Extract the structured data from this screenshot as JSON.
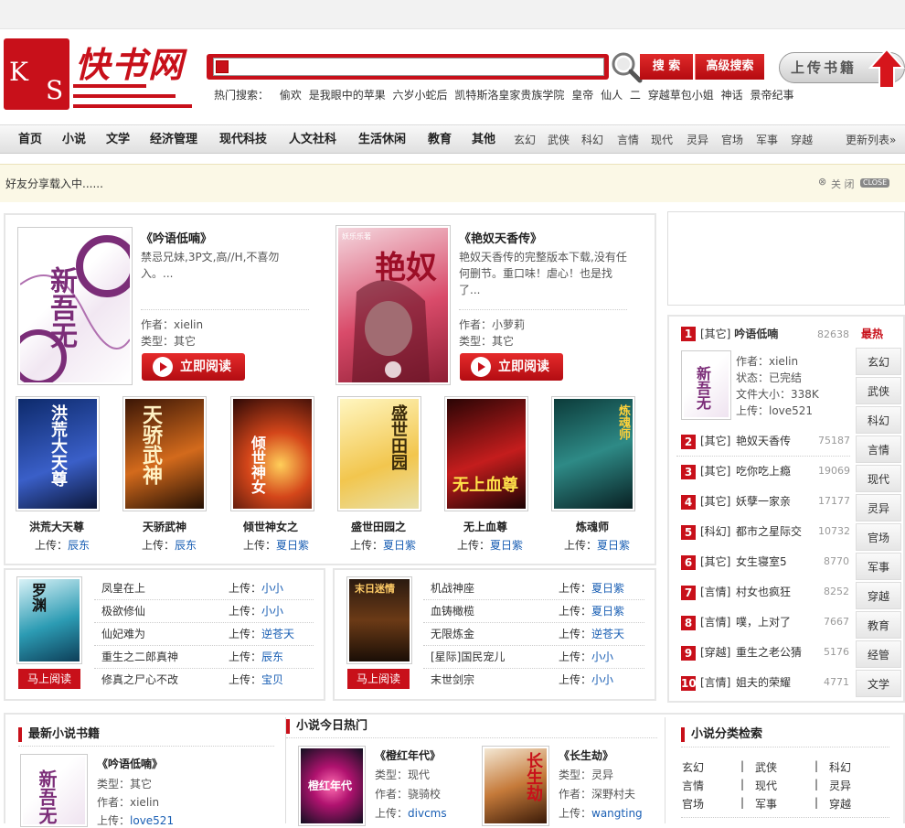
{
  "logo": {
    "ks_k": "K",
    "ks_s": "S",
    "name": "快书网"
  },
  "search": {
    "placeholder": "",
    "button": "搜 索",
    "advanced": "高级搜索",
    "upload": "上传书籍"
  },
  "hot": {
    "label": "热门搜索：",
    "items": [
      "偷欢",
      "是我眼中的苹果",
      "六岁小蛇后",
      "凯特斯洛皇家贵族学院",
      "皇帝",
      "仙人",
      "二",
      "穿越草包小姐",
      "神话",
      "景帝纪事"
    ]
  },
  "nav": {
    "main": [
      "首页",
      "小说",
      "文学",
      "经济管理",
      "现代科技",
      "人文社科",
      "生活休闲",
      "教育",
      "其他"
    ],
    "sub": [
      "玄幻",
      "武侠",
      "科幻",
      "言情",
      "现代",
      "灵异",
      "官场",
      "军事",
      "穿越"
    ],
    "more": "更新列表»"
  },
  "share": {
    "text": "好友分享载入中......",
    "close": "关 闭",
    "close_en": "CLOSE"
  },
  "featured": [
    {
      "title": "《吟语低喃》",
      "desc": "禁忌兄妹,3P文,高//H,不喜勿入。...",
      "author_label": "作者：",
      "author": "xielin",
      "type_label": "类型：",
      "type": "其它",
      "read": "立即阅读"
    },
    {
      "title": "《艳奴天香传》",
      "desc": "艳奴天香传的完整版本下载,没有任何删节。重口味！虐心！也是找了...",
      "author_label": "作者：",
      "author": "小萝莉",
      "type_label": "类型：",
      "type": "其它",
      "read": "立即阅读"
    }
  ],
  "cover_texts": {
    "c1": "新吾无",
    "c2": "艳奴",
    "c2_top": "妖乐乐著"
  },
  "grid": [
    {
      "title": "洪荒大天尊",
      "uploader": "辰东",
      "art": "洪荒大天尊"
    },
    {
      "title": "天骄武神",
      "uploader": "辰东",
      "art": "天骄武神"
    },
    {
      "title": "倾世神女之",
      "uploader": "夏日紫",
      "art": "倾世神女"
    },
    {
      "title": "盛世田园之",
      "uploader": "夏日紫",
      "art": "盛世田园"
    },
    {
      "title": "无上血尊",
      "uploader": "夏日紫",
      "art": "无上血尊"
    },
    {
      "title": "炼魂师",
      "uploader": "夏日紫",
      "art": "炼魂师"
    }
  ],
  "upload_label": "上传：",
  "list_left": {
    "cover": "罗渊",
    "read": "马上阅读",
    "rows": [
      {
        "t": "凤皇在上",
        "u": "小小"
      },
      {
        "t": "极欲修仙",
        "u": "小小"
      },
      {
        "t": "仙妃难为",
        "u": "逆苍天"
      },
      {
        "t": "重生之二郎真神",
        "u": "辰东"
      },
      {
        "t": "修真之尸心不改",
        "u": "宝贝"
      }
    ]
  },
  "list_right": {
    "cover": "末日迷情",
    "read": "马上阅读",
    "rows": [
      {
        "t": "机战神座",
        "u": "夏日紫"
      },
      {
        "t": "血铸橄榄",
        "u": "夏日紫"
      },
      {
        "t": "无限炼金",
        "u": "逆苍天"
      },
      {
        "t": "[星际]国民宠儿",
        "u": "小小"
      },
      {
        "t": "末世剑宗",
        "u": "小小"
      }
    ]
  },
  "rank": {
    "hot": "最热",
    "top": {
      "cat": "[其它]",
      "title": "吟语低喃",
      "count": "82638",
      "author": "作者：xielin",
      "status": "状态：已完结",
      "size": "文件大小：338K",
      "uploader": "上传：love521"
    },
    "items": [
      {
        "n": "2",
        "cat": "[其它]",
        "title": "艳奴天香传",
        "count": "75187"
      },
      {
        "n": "3",
        "cat": "[其它]",
        "title": "吃你吃上瘾",
        "count": "19069"
      },
      {
        "n": "4",
        "cat": "[其它]",
        "title": "妖孽一家亲",
        "count": "17177"
      },
      {
        "n": "5",
        "cat": "[科幻]",
        "title": "都市之星际交",
        "count": "10732"
      },
      {
        "n": "6",
        "cat": "[其它]",
        "title": "女生寝室5",
        "count": "8770"
      },
      {
        "n": "7",
        "cat": "[言情]",
        "title": "村女也疯狂",
        "count": "8252"
      },
      {
        "n": "8",
        "cat": "[言情]",
        "title": "噗，上对了",
        "count": "7667"
      },
      {
        "n": "9",
        "cat": "[穿越]",
        "title": "重生之老公猜",
        "count": "5176"
      },
      {
        "n": "10",
        "cat": "[言情]",
        "title": "姐夫的荣耀",
        "count": "4771"
      }
    ],
    "tabs": [
      "玄幻",
      "武侠",
      "科幻",
      "言情",
      "现代",
      "灵异",
      "官场",
      "军事",
      "穿越",
      "教育",
      "经管",
      "文学"
    ]
  },
  "latest": {
    "title": "最新小说书籍",
    "book": "《吟语低喃》",
    "type": "类型：其它",
    "author": "作者：xielin",
    "uploader_label": "上传：",
    "uploader": "love521"
  },
  "today": {
    "title": "小说今日热门",
    "books": [
      {
        "name": "《橙红年代》",
        "type": "类型：现代",
        "author": "作者：骁骑校",
        "uploader_label": "上传：",
        "uploader": "divcms",
        "art": "橙红年代"
      },
      {
        "name": "《长生劫》",
        "type": "类型：灵异",
        "author": "作者：深野村夫",
        "uploader_label": "上传：",
        "uploader": "wangting",
        "art": "长生劫"
      }
    ]
  },
  "cats": {
    "title": "小说分类检索",
    "items": [
      "玄幻",
      "武侠",
      "科幻",
      "言情",
      "现代",
      "灵异",
      "官场",
      "军事",
      "穿越"
    ]
  },
  "rank_first_number": "1",
  "colors": {
    "brand_red": "#c8101a",
    "link_blue": "#1a5fb4"
  }
}
